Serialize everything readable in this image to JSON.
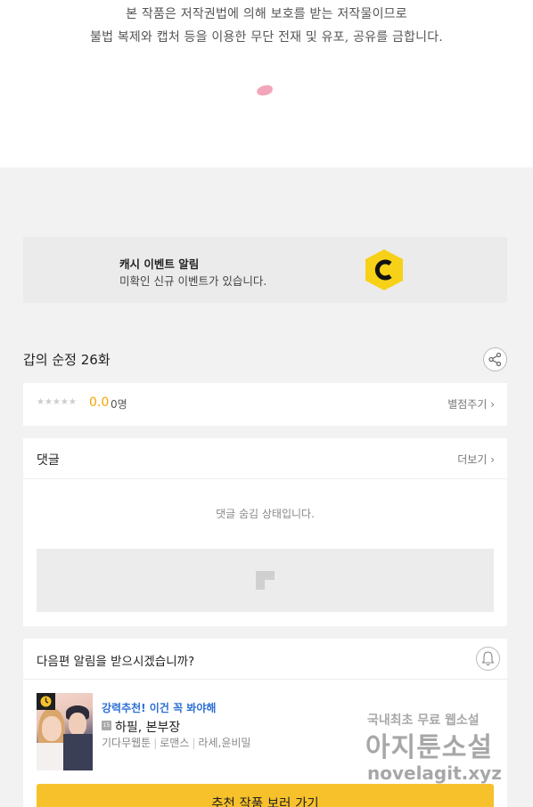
{
  "copyright": {
    "line1": "본 작품은 저작권법에 의해 보호를 받는 저작물이므로",
    "line2": "불법 복제와 캡처 등을 이용한 무단 전재 및 유포, 공유를 금합니다."
  },
  "cash_event": {
    "title": "캐시 이벤트 알림",
    "message": "미확인 신규 이벤트가 있습니다.",
    "logo_letter": "C",
    "logo_color": "#f7d117"
  },
  "episode": {
    "title": "갑의 순정 26화"
  },
  "rating": {
    "stars": "★★★★★",
    "score": "0.0",
    "people": "0명",
    "rate_label": "별점주기 ›"
  },
  "comments": {
    "title": "댓글",
    "more_label": "더보기 ›",
    "hidden_message": "댓글 숨김 상태입니다."
  },
  "next_alert": {
    "question": "다음편 알림을 받으시겠습니까?",
    "recommend_tag": "강력추천! 이건 꼭 봐야해",
    "age_badge": "15",
    "work_title": "하필, 본부장",
    "meta": [
      "기다무웹툰",
      "로맨스",
      "라세,윤비밀"
    ],
    "button_label": "추천 작품 보러 가기",
    "button_color": "#f7c12b"
  },
  "watermark": {
    "line1": "국내최초 무료 웹소설",
    "line2": "아지툰소설",
    "line3": "novelagit.xyz"
  }
}
